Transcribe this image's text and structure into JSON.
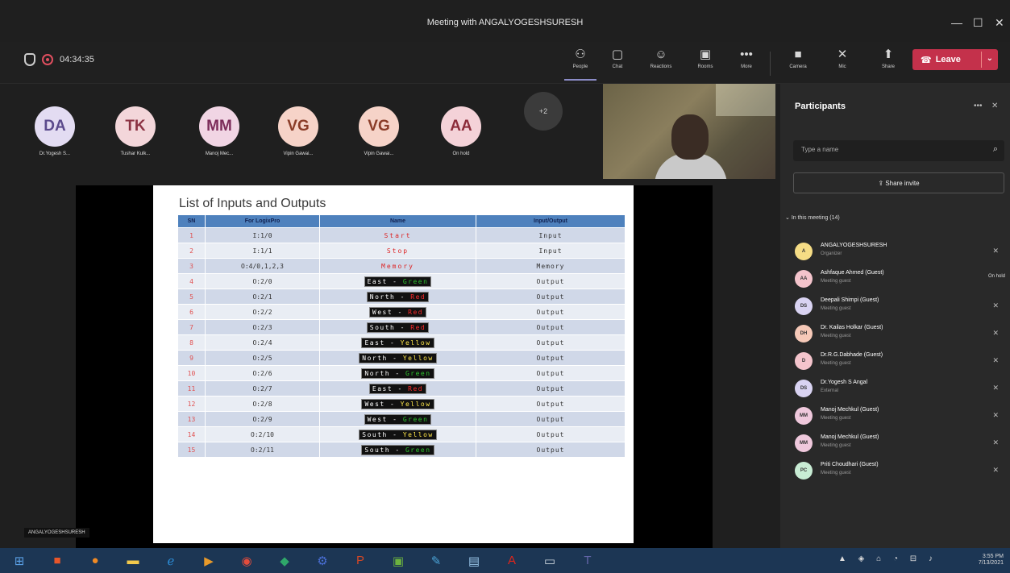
{
  "window": {
    "title": "Meeting with ANGALYOGESHSURESH"
  },
  "topbar": {
    "timer": "04:34:35",
    "buttons": [
      {
        "label": "People",
        "icon": "people-icon"
      },
      {
        "label": "Chat",
        "icon": "chat-icon"
      },
      {
        "label": "Reactions",
        "icon": "reactions-icon"
      },
      {
        "label": "Rooms",
        "icon": "rooms-icon"
      },
      {
        "label": "More",
        "icon": "more-icon"
      },
      {
        "label": "Camera",
        "icon": "camera-icon"
      },
      {
        "label": "Mic",
        "icon": "mic-icon"
      },
      {
        "label": "Share",
        "icon": "share-icon"
      }
    ],
    "leave_label": "Leave"
  },
  "participants_strip": [
    {
      "initials": "DA",
      "name": "Dr.Yogesh S...",
      "bg": "#e3dcf2",
      "fg": "#5b4a8c"
    },
    {
      "initials": "TK",
      "name": "Tushar Kulk...",
      "bg": "#f3d6da",
      "fg": "#8c3344"
    },
    {
      "initials": "MM",
      "name": "Manoj Mec...",
      "bg": "#f1d5e4",
      "fg": "#7c2c5a"
    },
    {
      "initials": "VG",
      "name": "Vipin Gawai...",
      "bg": "#f6d3c8",
      "fg": "#8a3c28"
    },
    {
      "initials": "VG",
      "name": "Vipin Gawai...",
      "bg": "#f6d3c8",
      "fg": "#8a3c28"
    },
    {
      "initials": "AA",
      "name": "On hold",
      "bg": "#f4d2d8",
      "fg": "#8c2c3a"
    }
  ],
  "more_count": "+2",
  "presenter_label": "ANGALYOGESHSURESH",
  "slide": {
    "title": "List of Inputs and Outputs",
    "headers": [
      "SN",
      "For LogixPro",
      "Name",
      "Input/Output"
    ],
    "rows": [
      {
        "sn": "1",
        "addr": "I:1/0",
        "name_parts": [
          "Start"
        ],
        "io": "Input"
      },
      {
        "sn": "2",
        "addr": "I:1/1",
        "name_parts": [
          "Stop"
        ],
        "io": "Input"
      },
      {
        "sn": "3",
        "addr": "O:4/0,1,2,3",
        "name_parts": [
          "Memory"
        ],
        "io": "Memory"
      },
      {
        "sn": "4",
        "addr": "O:2/0",
        "name_parts": [
          "East",
          "Green"
        ],
        "io": "Output"
      },
      {
        "sn": "5",
        "addr": "O:2/1",
        "name_parts": [
          "North",
          "Red"
        ],
        "io": "Output"
      },
      {
        "sn": "6",
        "addr": "O:2/2",
        "name_parts": [
          "West",
          "Red"
        ],
        "io": "Output"
      },
      {
        "sn": "7",
        "addr": "O:2/3",
        "name_parts": [
          "South",
          "Red"
        ],
        "io": "Output"
      },
      {
        "sn": "8",
        "addr": "O:2/4",
        "name_parts": [
          "East",
          "Yellow"
        ],
        "io": "Output"
      },
      {
        "sn": "9",
        "addr": "O:2/5",
        "name_parts": [
          "North",
          "Yellow"
        ],
        "io": "Output"
      },
      {
        "sn": "10",
        "addr": "O:2/6",
        "name_parts": [
          "North",
          "Green"
        ],
        "io": "Output"
      },
      {
        "sn": "11",
        "addr": "O:2/7",
        "name_parts": [
          "East",
          "Red"
        ],
        "io": "Output"
      },
      {
        "sn": "12",
        "addr": "O:2/8",
        "name_parts": [
          "West",
          "Yellow"
        ],
        "io": "Output"
      },
      {
        "sn": "13",
        "addr": "O:2/9",
        "name_parts": [
          "West",
          "Green"
        ],
        "io": "Output"
      },
      {
        "sn": "14",
        "addr": "O:2/10",
        "name_parts": [
          "South",
          "Yellow"
        ],
        "io": "Output"
      },
      {
        "sn": "15",
        "addr": "O:2/11",
        "name_parts": [
          "South",
          "Green"
        ],
        "io": "Output"
      }
    ]
  },
  "panel": {
    "title": "Participants",
    "search_placeholder": "Type a name",
    "invite_label": "Share invite",
    "section_label": "In this meeting (14)",
    "people": [
      {
        "initials": "A",
        "name": "ANGALYOGESHSURESH",
        "role": "Organizer",
        "bg": "#f5dc85",
        "hold": ""
      },
      {
        "initials": "AA",
        "name": "Ashfaque Ahmed (Guest)",
        "role": "Meeting guest",
        "bg": "#f4c4cc",
        "hold": "On hold"
      },
      {
        "initials": "DS",
        "name": "Deepali Shimpi (Guest)",
        "role": "Meeting guest",
        "bg": "#d9d3f2",
        "hold": ""
      },
      {
        "initials": "DH",
        "name": "Dr. Kailas Holkar (Guest)",
        "role": "Meeting guest",
        "bg": "#f6c9b8",
        "hold": ""
      },
      {
        "initials": "D",
        "name": "Dr.R.G.Dabhade (Guest)",
        "role": "Meeting guest",
        "bg": "#f4c4cc",
        "hold": ""
      },
      {
        "initials": "DS",
        "name": "Dr.Yogesh S Angal",
        "role": "External",
        "bg": "#d9d3f2",
        "hold": ""
      },
      {
        "initials": "MM",
        "name": "Manoj Mechkul (Guest)",
        "role": "Meeting guest",
        "bg": "#efc8dc",
        "hold": ""
      },
      {
        "initials": "MM",
        "name": "Manoj Mechkul (Guest)",
        "role": "Meeting guest",
        "bg": "#efc8dc",
        "hold": ""
      },
      {
        "initials": "PC",
        "name": "Priti Choudhari (Guest)",
        "role": "Meeting guest",
        "bg": "#c8ecd4",
        "hold": ""
      }
    ]
  },
  "taskbar": {
    "icons": [
      {
        "icon": "windows-start-icon",
        "color": "#5aa0e6"
      },
      {
        "icon": "office-icon",
        "color": "#e8562a"
      },
      {
        "icon": "firefox-icon",
        "color": "#f08a24"
      },
      {
        "icon": "file-explorer-icon",
        "color": "#f2c94c"
      },
      {
        "icon": "internet-explorer-icon",
        "color": "#2b8cd6"
      },
      {
        "icon": "media-player-icon",
        "color": "#e89a2a"
      },
      {
        "icon": "chrome-icon",
        "color": "#e34c3c"
      },
      {
        "icon": "app-icon",
        "color": "#2fa86a"
      },
      {
        "icon": "settings-icon",
        "color": "#4a6fd6"
      },
      {
        "icon": "powerpoint-icon",
        "color": "#d24726"
      },
      {
        "icon": "image-icon",
        "color": "#6cb33f"
      },
      {
        "icon": "paint-icon",
        "color": "#4ba3d6"
      },
      {
        "icon": "notes-icon",
        "color": "#9ac6e8"
      },
      {
        "icon": "acrobat-icon",
        "color": "#e0251b"
      },
      {
        "icon": "window-icon",
        "color": "#cfd8e0"
      },
      {
        "icon": "teams-icon",
        "color": "#6264a7"
      }
    ],
    "time": "3:55 PM",
    "date": "7/13/2021"
  }
}
